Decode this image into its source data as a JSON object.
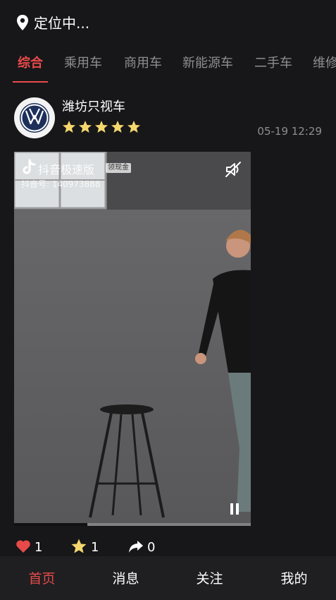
{
  "location": {
    "text": "定位中..."
  },
  "tabs": [
    {
      "label": "综合",
      "active": true
    },
    {
      "label": "乘用车",
      "active": false
    },
    {
      "label": "商用车",
      "active": false
    },
    {
      "label": "新能源车",
      "active": false
    },
    {
      "label": "二手车",
      "active": false
    },
    {
      "label": "维修",
      "active": false
    }
  ],
  "post": {
    "author": "潍坊只视车",
    "rating": 5,
    "time": "05-19 12:29",
    "video": {
      "watermark_title": "抖音极速版",
      "watermark_badge": "领现金",
      "watermark_id": "抖音号: 140973888",
      "progress": 0.31
    },
    "likes": "1",
    "favorites": "1",
    "shares": "0"
  },
  "nav": [
    {
      "label": "首页",
      "active": true
    },
    {
      "label": "消息",
      "active": false
    },
    {
      "label": "关注",
      "active": false
    },
    {
      "label": "我的",
      "active": false
    }
  ],
  "colors": {
    "accent": "#e84a4a",
    "background": "#171719",
    "star": "#f5d76e"
  }
}
